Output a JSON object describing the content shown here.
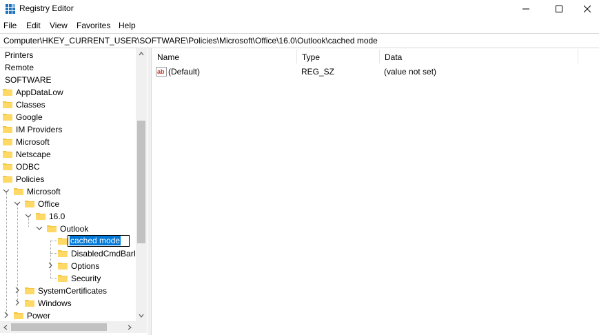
{
  "window": {
    "title": "Registry Editor",
    "minimize_icon": "minimize-icon",
    "maximize_icon": "maximize-icon",
    "close_icon": "close-icon"
  },
  "menu": [
    "File",
    "Edit",
    "View",
    "Favorites",
    "Help"
  ],
  "address": "Computer\\HKEY_CURRENT_USER\\SOFTWARE\\Policies\\Microsoft\\Office\\16.0\\Outlook\\cached mode",
  "tree": {
    "items": [
      {
        "label": "Printers"
      },
      {
        "label": "Remote"
      },
      {
        "label": "SOFTWARE"
      },
      {
        "label": "AppDataLow"
      },
      {
        "label": "Classes"
      },
      {
        "label": "Google"
      },
      {
        "label": "IM Providers"
      },
      {
        "label": "Microsoft"
      },
      {
        "label": "Netscape"
      },
      {
        "label": "ODBC"
      },
      {
        "label": "Policies"
      },
      {
        "label": "Microsoft"
      },
      {
        "label": "Office"
      },
      {
        "label": "16.0"
      },
      {
        "label": "Outlook"
      },
      {
        "label": "cached mode"
      },
      {
        "label": "DisabledCmdBarIt"
      },
      {
        "label": "Options"
      },
      {
        "label": "Security"
      },
      {
        "label": "SystemCertificates"
      },
      {
        "label": "Windows"
      },
      {
        "label": "Power"
      }
    ]
  },
  "list": {
    "columns": [
      "Name",
      "Type",
      "Data"
    ],
    "rows": [
      {
        "name": "(Default)",
        "type": "REG_SZ",
        "data": "(value not set)"
      }
    ]
  },
  "colors": {
    "folder": "#f5c542",
    "selection": "#0078d7",
    "regsz_icon": "#c0392b"
  }
}
